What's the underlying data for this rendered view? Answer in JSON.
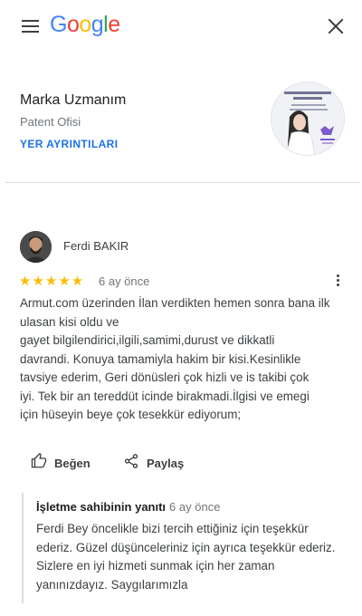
{
  "header": {
    "logo_letters": [
      {
        "char": "G",
        "color": "#4285F4"
      },
      {
        "char": "o",
        "color": "#EA4335"
      },
      {
        "char": "o",
        "color": "#FBBC05"
      },
      {
        "char": "g",
        "color": "#4285F4"
      },
      {
        "char": "l",
        "color": "#34A853"
      },
      {
        "char": "e",
        "color": "#EA4335"
      }
    ],
    "menu_icon": "hamburger-menu-icon",
    "close_icon": "close-icon"
  },
  "place": {
    "name": "Marka Uzmanım",
    "category": "Patent Ofisi",
    "details_link": "YER AYRINTILARI"
  },
  "review": {
    "author": "Ferdi BAKIR",
    "rating": 5,
    "stars": "★★★★★",
    "time": "6 ay önce",
    "text_lines": [
      "Armut.com üzerinden İlan verdikten hemen sonra bana ilk",
      "ulasan kisi oldu ve",
      "gayet bilgilendirici,ilgili,samimi,durust ve dikkatli",
      "davrandi. Konuya tamamiyla hakim bir kisi.Kesinlikle",
      "tavsiye ederim, Geri dönüsleri çok hizli ve is takibi çok",
      "iyi. Tek bir an tereddüt icinde birakmadi.İlgisi ve emegi",
      "için hüseyin beye çok tesekkür ediyorum;"
    ]
  },
  "actions": {
    "like_label": "Beğen",
    "share_label": "Paylaş"
  },
  "owner_response": {
    "title": "İşletme sahibinin yanıtı",
    "time": "6 ay önce",
    "text_lines": [
      "Ferdi Bey öncelikle bizi tercih ettiğiniz için teşekkür",
      "ederiz. Güzel düşünceleriniz için ayrıca teşekkür ederiz.",
      "Sizlere en iyi hizmeti sunmak için her zaman",
      "yanınızdayız. Saygılarımızla"
    ]
  },
  "colors": {
    "link_blue": "#1a73e8",
    "star_yellow": "#fbbc04",
    "text_gray": "#3c4043",
    "secondary_gray": "#70757a"
  }
}
